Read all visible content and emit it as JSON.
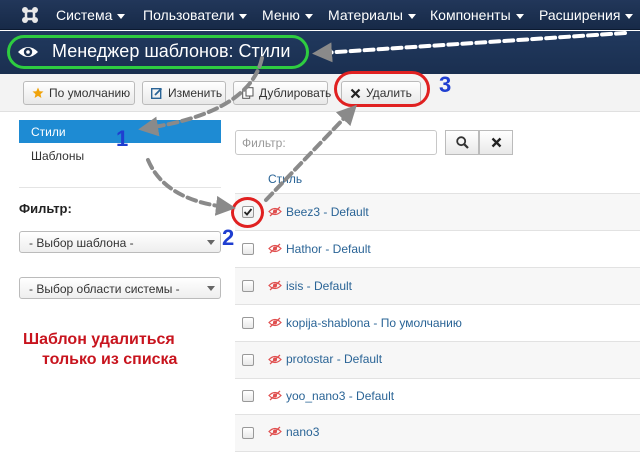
{
  "navbar": {
    "items": [
      {
        "label": "Система"
      },
      {
        "label": "Пользователи"
      },
      {
        "label": "Меню"
      },
      {
        "label": "Материалы"
      },
      {
        "label": "Компоненты"
      },
      {
        "label": "Расширения"
      }
    ]
  },
  "titlebar": {
    "title": "Менеджер шаблонов: Стили"
  },
  "toolbar": {
    "default_label": "По умолчанию",
    "edit_label": "Изменить",
    "duplicate_label": "Дублировать",
    "delete_label": "Удалить"
  },
  "sidebar": {
    "items": [
      {
        "label": "Стили",
        "active": true
      },
      {
        "label": "Шаблоны",
        "active": false
      }
    ],
    "filter_title": "Фильтр:",
    "select_template": "- Выбор шаблона -",
    "select_area": "- Выбор области системы -"
  },
  "filter": {
    "placeholder": "Фильтр:"
  },
  "table": {
    "column_header": "Стиль",
    "rows": [
      {
        "label": "Beez3 - Default",
        "checked": true
      },
      {
        "label": "Hathor - Default",
        "checked": false
      },
      {
        "label": "isis - Default",
        "checked": false
      },
      {
        "label": "kopija-shablona - По умолчанию",
        "checked": false
      },
      {
        "label": "protostar - Default",
        "checked": false
      },
      {
        "label": "yoo_nano3 - Default",
        "checked": false
      },
      {
        "label": "nano3",
        "checked": false
      }
    ]
  },
  "annotations": {
    "step1": "1",
    "step2": "2",
    "step3": "3",
    "warning_line1": "Шаблон удалиться",
    "warning_line2": "только из списка"
  },
  "colors": {
    "navbar": "#1c3150",
    "accent_blue": "#1e8bd3",
    "link": "#2a6496",
    "highlight_green": "#2ecc40",
    "highlight_red": "#e02020",
    "step_numbers": "#1f3ed0",
    "warning_text": "#c8141e"
  },
  "icons": {
    "logo": "joomla-logo",
    "title": "eye-icon",
    "default": "star-icon",
    "edit": "edit-icon",
    "duplicate": "copy-icon",
    "delete": "x-icon",
    "search": "search-icon",
    "clear": "close-icon",
    "row": "hidden-eye-icon"
  }
}
